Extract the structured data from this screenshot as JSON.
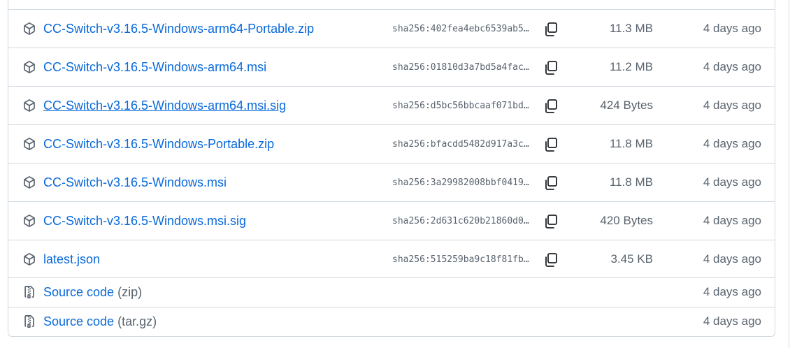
{
  "assets": [
    {
      "name": "CC-Switch-v3.16.5-Windows-arm64-Portable.zip",
      "sha": "sha256:402fea4ebc6539ab5…",
      "size": "11.3 MB",
      "date": "4 days ago",
      "icon": "package-icon",
      "underlined": false
    },
    {
      "name": "CC-Switch-v3.16.5-Windows-arm64.msi",
      "sha": "sha256:01810d3a7bd5a4fac…",
      "size": "11.2 MB",
      "date": "4 days ago",
      "icon": "package-icon",
      "underlined": false
    },
    {
      "name": "CC-Switch-v3.16.5-Windows-arm64.msi.sig",
      "sha": "sha256:d5bc56bbcaaf071bd…",
      "size": "424 Bytes",
      "date": "4 days ago",
      "icon": "package-icon",
      "underlined": true
    },
    {
      "name": "CC-Switch-v3.16.5-Windows-Portable.zip",
      "sha": "sha256:bfacdd5482d917a3c…",
      "size": "11.8 MB",
      "date": "4 days ago",
      "icon": "package-icon",
      "underlined": false
    },
    {
      "name": "CC-Switch-v3.16.5-Windows.msi",
      "sha": "sha256:3a29982008bbf0419…",
      "size": "11.8 MB",
      "date": "4 days ago",
      "icon": "package-icon",
      "underlined": false
    },
    {
      "name": "CC-Switch-v3.16.5-Windows.msi.sig",
      "sha": "sha256:2d631c620b21860d0…",
      "size": "420 Bytes",
      "date": "4 days ago",
      "icon": "package-icon",
      "underlined": false
    },
    {
      "name": "latest.json",
      "sha": "sha256:515259ba9c18f81fb…",
      "size": "3.45 KB",
      "date": "4 days ago",
      "icon": "package-icon",
      "underlined": false
    }
  ],
  "source_code": [
    {
      "name": "Source code",
      "ext": "(zip)",
      "date": "4 days ago",
      "icon": "file-zip-icon"
    },
    {
      "name": "Source code",
      "ext": "(tar.gz)",
      "date": "4 days ago",
      "icon": "file-zip-icon"
    }
  ],
  "colors": {
    "link": "#0969da",
    "muted": "#59636e",
    "border": "#d1d9e0"
  }
}
